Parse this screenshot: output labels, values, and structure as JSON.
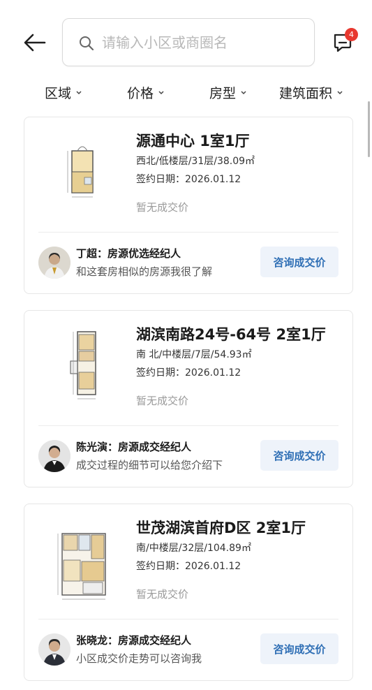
{
  "search": {
    "placeholder": "请输入小区或商圈名"
  },
  "messages": {
    "badge": "4"
  },
  "filters": [
    {
      "label": "区域"
    },
    {
      "label": "价格"
    },
    {
      "label": "房型"
    },
    {
      "label": "建筑面积"
    }
  ],
  "listings": [
    {
      "title": "源通中心 1室1厅",
      "meta": "西北/低楼层/31层/38.09㎡",
      "date": "签约日期：2026.01.12",
      "price_status": "暂无成交价",
      "agent_name": "丁超：房源优选经纪人",
      "agent_desc": "和这套房相似的房源我很了解",
      "button": "咨询成交价"
    },
    {
      "title": "湖滨南路24号-64号 2室1厅",
      "meta": "南 北/中楼层/7层/54.93㎡",
      "date": "签约日期：2026.01.12",
      "price_status": "暂无成交价",
      "agent_name": "陈光演：房源成交经纪人",
      "agent_desc": "成交过程的细节可以给您介绍下",
      "button": "咨询成交价"
    },
    {
      "title": "世茂湖滨首府D区 2室1厅",
      "meta": "南/中楼层/32层/104.89㎡",
      "date": "签约日期：2026.01.12",
      "price_status": "暂无成交价",
      "agent_name": "张晓龙：房源成交经纪人",
      "agent_desc": "小区成交价走势可以咨询我",
      "button": "咨询成交价"
    }
  ],
  "colors": {
    "accent": "#2f6fb5",
    "button_bg": "#eef3fa",
    "badge": "#e8382f"
  }
}
